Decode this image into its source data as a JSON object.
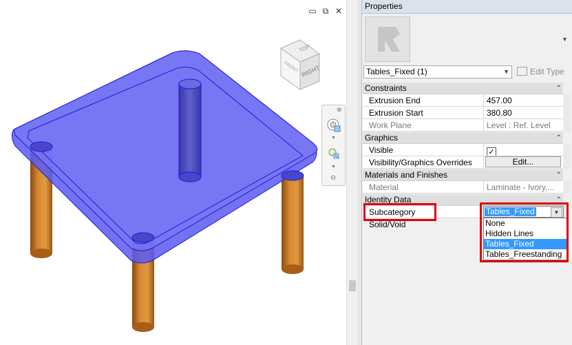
{
  "viewport": {
    "window_controls": {
      "minimize": "▭",
      "restore": "⧉",
      "close": "✕"
    },
    "viewcube": {
      "top": "TOP",
      "front": "FRONT",
      "right": "RIGHT"
    },
    "colors": {
      "tabletop_fill": "#5a5af0",
      "tabletop_edge": "#1a1ae0",
      "leg_wood": "#c8701a"
    }
  },
  "properties": {
    "title": "Properties",
    "type_selector": "Tables_Fixed (1)",
    "edit_type": "Edit Type",
    "groups": [
      {
        "name": "Constraints",
        "rows": [
          {
            "label": "Extrusion End",
            "value": "457.00"
          },
          {
            "label": "Extrusion Start",
            "value": "380.80"
          },
          {
            "label": "Work Plane",
            "value": "Level : Ref. Level"
          }
        ]
      },
      {
        "name": "Graphics",
        "rows": [
          {
            "label": "Visible",
            "value": "✓"
          },
          {
            "label": "Visibility/Graphics Overrides",
            "value": "Edit..."
          }
        ]
      },
      {
        "name": "Materials and Finishes",
        "rows": [
          {
            "label": "Material",
            "value": "Laminate - Ivory,..."
          }
        ]
      },
      {
        "name": "Identity Data",
        "rows": [
          {
            "label": "Subcategory",
            "value": "Tables_Fixed"
          },
          {
            "label": "Solid/Void",
            "value": ""
          }
        ]
      }
    ],
    "subcategory_dropdown": {
      "selected": "Tables_Fixed",
      "options": [
        "None",
        "Hidden Lines",
        "Tables_Fixed",
        "Tables_Freestanding"
      ]
    },
    "highlight_color": "#e00000"
  }
}
